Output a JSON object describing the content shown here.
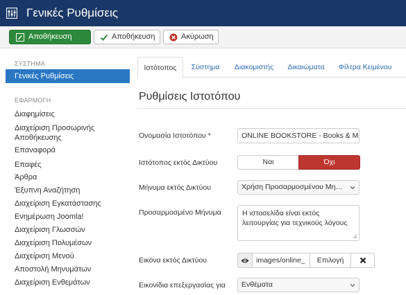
{
  "header": {
    "title": "Γενικές Ρυθμίσεις",
    "icon": "sliders-icon"
  },
  "toolbar": {
    "save_close_label": "Αποθήκευση",
    "save_label": "Αποθήκευση",
    "cancel_label": "Ακύρωση",
    "accent": "#2d8a3c"
  },
  "sidebar": {
    "system_heading": "ΣΥΣΤΗΜΑ",
    "active_item": "Γενικές Ρυθμίσεις",
    "app_heading": "ΕΦΑΡΜΟΓΗ",
    "items": [
      "Διαφημίσεις",
      "Διαχείριση Προσωρινής Αποθήκευσης",
      "Επαναφορά",
      "Επαφές",
      "Άρθρα",
      "Έξυπνη Αναζήτηση",
      "Διαχείριση Εγκατάστασης",
      "Ενημέρωση Joomla!",
      "Διαχείριση Γλωσσών",
      "Διαχείριση Πολυμέσων",
      "Διαχείριση Μενού",
      "Αποστολή Μηνυμάτων",
      "Διαχείριση Ενθεμάτων"
    ]
  },
  "tabs": [
    "Ιστότοπος",
    "Σύστημα",
    "Διακομιστής",
    "Δικαιώματα",
    "Φίλτρα Κειμένου"
  ],
  "main": {
    "section_title": "Ρυθμίσεις Ιστοτόπου",
    "site_name_label": "Ονομασία Ιστοτόπου *",
    "site_name_value": "ONLINE BOOKSTORE - Books & M",
    "offline_label": "Ιστότοπος εκτός Δικτύου",
    "offline_yes": "Ναι",
    "offline_no": "Όχι",
    "offline_message_label": "Μήνυμα εκτός Δικτύου",
    "offline_message_value": "Χρήση Προσαρμοσμένου Μη…",
    "custom_message_label": "Προσαρμοσμένο Μήνυμα",
    "custom_message_line1": "Η ιστοσελίδα είναι εκτός",
    "custom_message_line2": "λειτουργίας για τεχνικούς λόγους",
    "offline_image_label": "Εικόνα εκτός Δικτύου",
    "offline_image_path": "images/online_",
    "offline_image_select": "Επιλογή",
    "edit_buttons_label": "Εικονίδια επεξεργασίας για",
    "edit_buttons_value": "Ενθέματα"
  }
}
